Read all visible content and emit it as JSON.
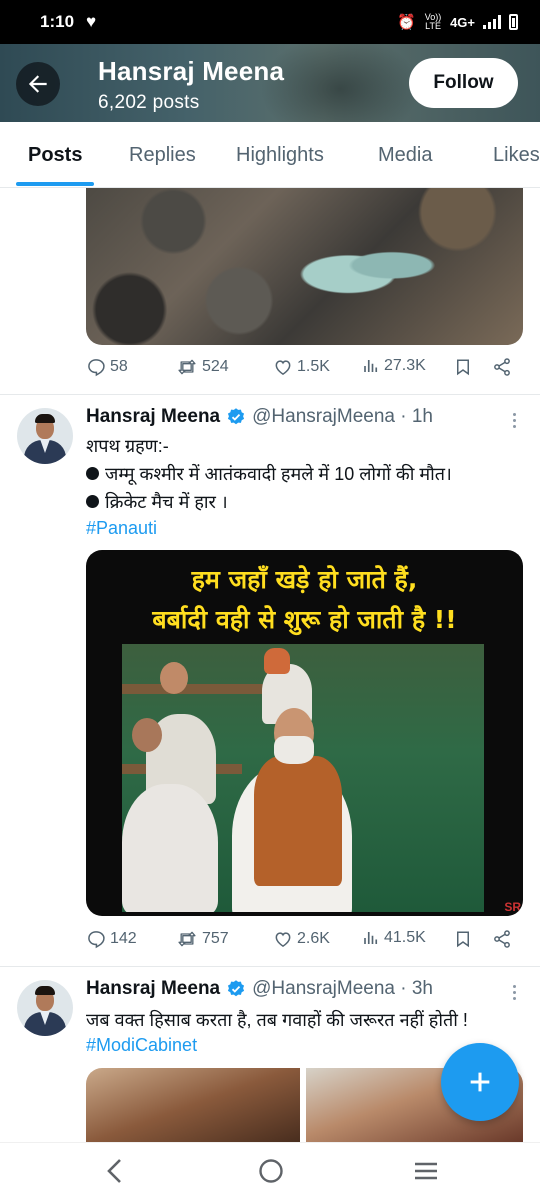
{
  "status_bar": {
    "time": "1:10",
    "network": "4G+",
    "volte": "Vo)) LTE"
  },
  "header": {
    "name": "Hansraj Meena",
    "posts": "6,202 posts",
    "follow_label": "Follow"
  },
  "tabs": [
    {
      "label": "Posts",
      "active": true
    },
    {
      "label": "Replies",
      "active": false
    },
    {
      "label": "Highlights",
      "active": false
    },
    {
      "label": "Media",
      "active": false
    },
    {
      "label": "Likes",
      "active": false
    }
  ],
  "posts": [
    {
      "stats": {
        "replies": "58",
        "reposts": "524",
        "likes": "1.5K",
        "views": "27.3K"
      }
    },
    {
      "author": "Hansraj Meena",
      "handle": "@HansrajMeena · 1h",
      "lines": [
        "शपथ ग्रहण:-",
        "जम्मू कश्मीर में आतंकवादी हमले में 10 लोगों की मौत।",
        "क्रिकेट मैच में हार ।"
      ],
      "hashtag": "#Panauti",
      "image_text": [
        "हम जहाँ खड़े हो जाते हैं,",
        "बर्बादी वही से शुरू हो जाती है !!"
      ],
      "watermark": "SR",
      "stats": {
        "replies": "142",
        "reposts": "757",
        "likes": "2.6K",
        "views": "41.5K"
      }
    },
    {
      "author": "Hansraj Meena",
      "handle": "@HansrajMeena · 3h",
      "lines": [
        "जब वक्त हिसाब करता है, तब गवाहों की जरूरत नहीं होती !"
      ],
      "hashtag": "#ModiCabinet"
    }
  ],
  "colors": {
    "accent": "#1d9bf0",
    "text": "#0f1419",
    "muted": "#536471",
    "meme_text": "#ffde1f"
  },
  "icons": [
    "back-arrow-icon",
    "reply-icon",
    "repost-icon",
    "like-icon",
    "views-icon",
    "bookmark-icon",
    "share-icon",
    "verified-icon",
    "more-icon",
    "compose-icon",
    "nav-back-icon",
    "nav-home-icon",
    "nav-recents-icon"
  ]
}
